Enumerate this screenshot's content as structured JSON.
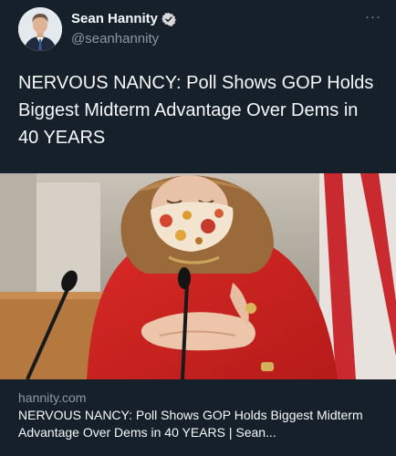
{
  "tweet": {
    "author": {
      "display_name": "Sean Hannity",
      "handle": "@seanhannity"
    },
    "more_glyph": "···",
    "text": "NERVOUS NANCY: Poll Shows GOP Holds Biggest Midterm Advantage Over Dems in 40 YEARS"
  },
  "card": {
    "domain": "hannity.com",
    "title": "NERVOUS NANCY: Poll Shows GOP Holds Biggest Midterm Advantage Over Dems in 40 YEARS | Sean..."
  },
  "colors": {
    "background": "#15202b",
    "primary_text": "#f7f9f9",
    "secondary_text": "#8b98a5",
    "verified_badge": "#d9d9d9"
  },
  "icons": [
    "verified-badge-icon",
    "more-options-icon"
  ]
}
